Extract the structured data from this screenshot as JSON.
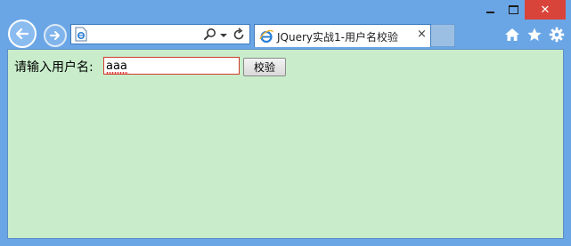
{
  "window": {
    "tab_title": "JQuery实战1-用户名校验",
    "tab_close_glyph": "×",
    "close_glyph": "✕",
    "address_value": ""
  },
  "icons": {
    "back": "back-arrow-icon",
    "forward": "forward-arrow-icon",
    "page": "ie-page-icon",
    "search": "search-icon",
    "dropdown": "chevron-down-icon",
    "refresh": "refresh-icon",
    "home": "home-icon",
    "favorites": "star-icon",
    "tools": "gear-icon"
  },
  "form": {
    "label": "请输入用户名:",
    "input_value": "aaa",
    "button_label": "校验"
  },
  "colors": {
    "chrome": "#6aa6e6",
    "content_bg": "#c9edcb",
    "close_button": "#d9443a",
    "input_border": "#d03a2a"
  }
}
